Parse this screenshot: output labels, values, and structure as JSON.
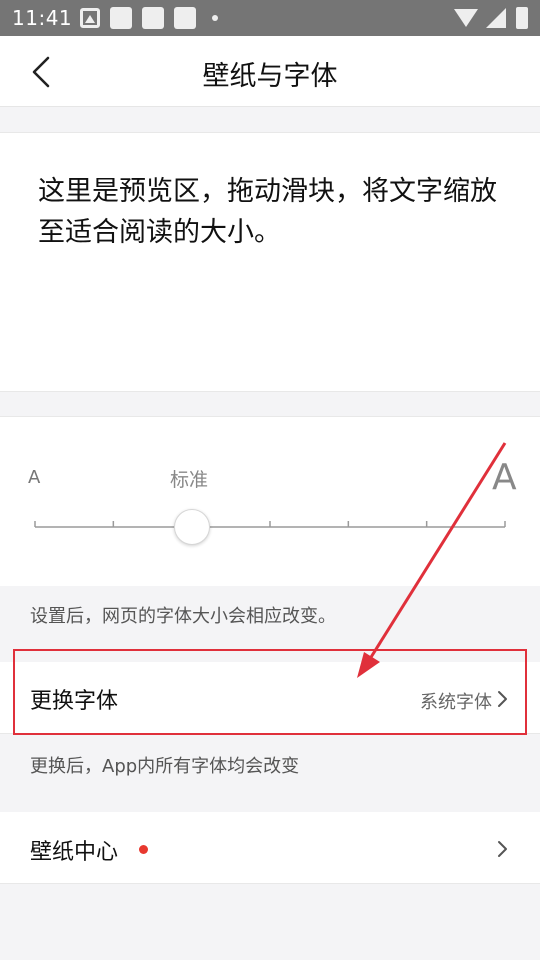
{
  "status_bar": {
    "time": "11:41",
    "icons": [
      "image-icon",
      "notification-icon",
      "notification-icon",
      "notification-icon",
      "more-dot-icon",
      "wifi-icon",
      "signal-icon",
      "battery-icon"
    ]
  },
  "nav": {
    "back_icon": "back-arrow-icon",
    "title": "壁纸与字体"
  },
  "preview": {
    "text": "这里是预览区，拖动滑块，将文字缩放至适合阅读的大小。"
  },
  "font_size": {
    "small_label": "A",
    "large_label": "A",
    "current_label": "标准",
    "steps": 7,
    "selected_index": 2
  },
  "hint_font_size": "设置后，网页的字体大小会相应改变。",
  "font_row": {
    "label": "更换字体",
    "value": "系统字体",
    "chevron_icon": "chevron-right-icon"
  },
  "hint_font_change": "更换后，App内所有字体均会改变",
  "wallpaper_row": {
    "label": "壁纸中心",
    "badge": "red-dot",
    "chevron_icon": "chevron-right-icon"
  },
  "colors": {
    "status_bar": "#757575",
    "annotation_red": "#e0303b",
    "badge_red": "#e8382f",
    "background": "#f4f4f6"
  }
}
